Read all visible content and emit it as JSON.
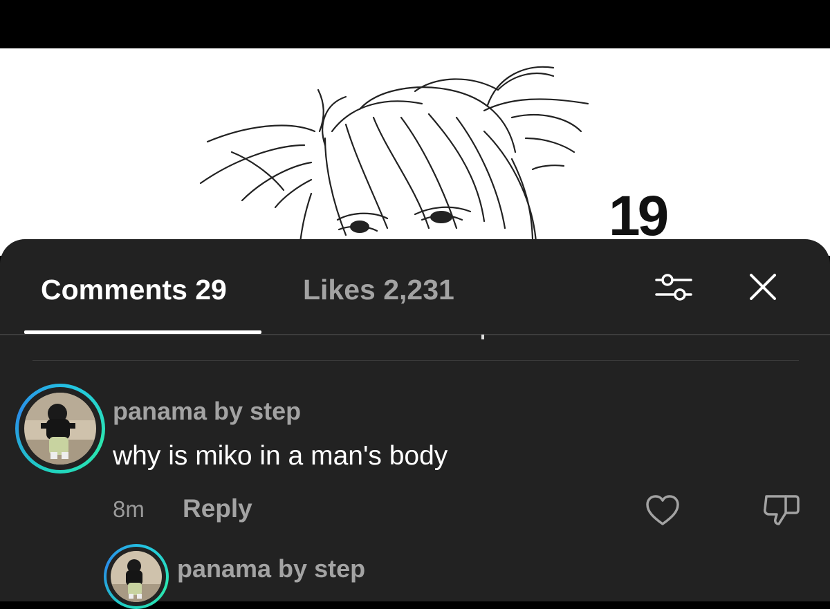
{
  "artwork": {
    "number_text": "19"
  },
  "sheet": {
    "tabs": [
      {
        "label": "Comments 29",
        "active": true
      },
      {
        "label": "Likes 2,231",
        "active": false
      }
    ],
    "icons": {
      "filter": "sliders-icon",
      "close": "close-icon",
      "like": "heart-outline-icon",
      "dislike": "thumbs-down-icon"
    }
  },
  "comments": [
    {
      "username": "panama by step",
      "text": "why is miko in a man's body",
      "time": "8m",
      "reply_label": "Reply"
    }
  ],
  "reply_preview": {
    "username": "panama by step"
  },
  "colors": {
    "sheet_background": "#222222",
    "avatar_ring": "#1fd1c1",
    "secondary_text": "#a3a3a3"
  }
}
